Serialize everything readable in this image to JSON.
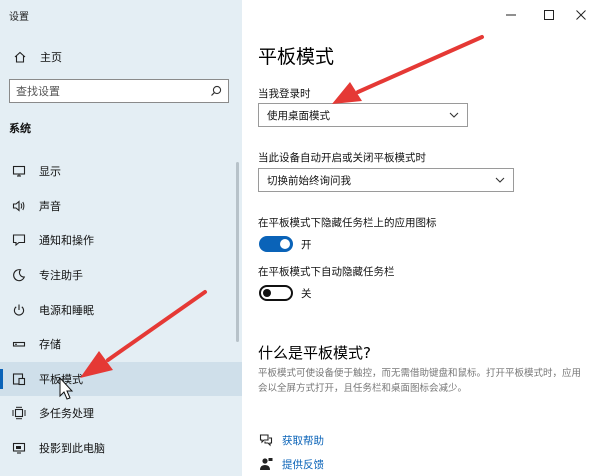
{
  "window": {
    "title": "设置"
  },
  "sidebar": {
    "home_label": "主页",
    "search_placeholder": "查找设置",
    "section_title": "系统",
    "items": [
      {
        "label": "显示",
        "icon": "monitor-icon"
      },
      {
        "label": "声音",
        "icon": "speaker-icon"
      },
      {
        "label": "通知和操作",
        "icon": "notification-icon"
      },
      {
        "label": "专注助手",
        "icon": "moon-icon"
      },
      {
        "label": "电源和睡眠",
        "icon": "power-icon"
      },
      {
        "label": "存储",
        "icon": "storage-icon"
      },
      {
        "label": "平板模式",
        "icon": "tablet-mode-icon",
        "active": true
      },
      {
        "label": "多任务处理",
        "icon": "multitask-icon"
      },
      {
        "label": "投影到此电脑",
        "icon": "project-icon"
      }
    ]
  },
  "main": {
    "title": "平板模式",
    "signin_label": "当我登录时",
    "signin_value": "使用桌面模式",
    "auto_switch_label": "当此设备自动开启或关闭平板模式时",
    "auto_switch_value": "切换前始终询问我",
    "hide_icons_label": "在平板模式下隐藏任务栏上的应用图标",
    "hide_icons_state": "开",
    "auto_hide_label": "在平板模式下自动隐藏任务栏",
    "auto_hide_state": "关",
    "what_is_title": "什么是平板模式?",
    "what_is_desc": "平板模式可使设备便于触控，而无需借助键盘和鼠标。打开平板模式时，应用会以全屏方式打开，且任务栏和桌面图标会减少。",
    "help_link": "获取帮助",
    "feedback_link": "提供反馈"
  },
  "colors": {
    "accent": "#0a63b8",
    "sidebar_bg": "#e4eef4",
    "arrow": "#e53935"
  }
}
